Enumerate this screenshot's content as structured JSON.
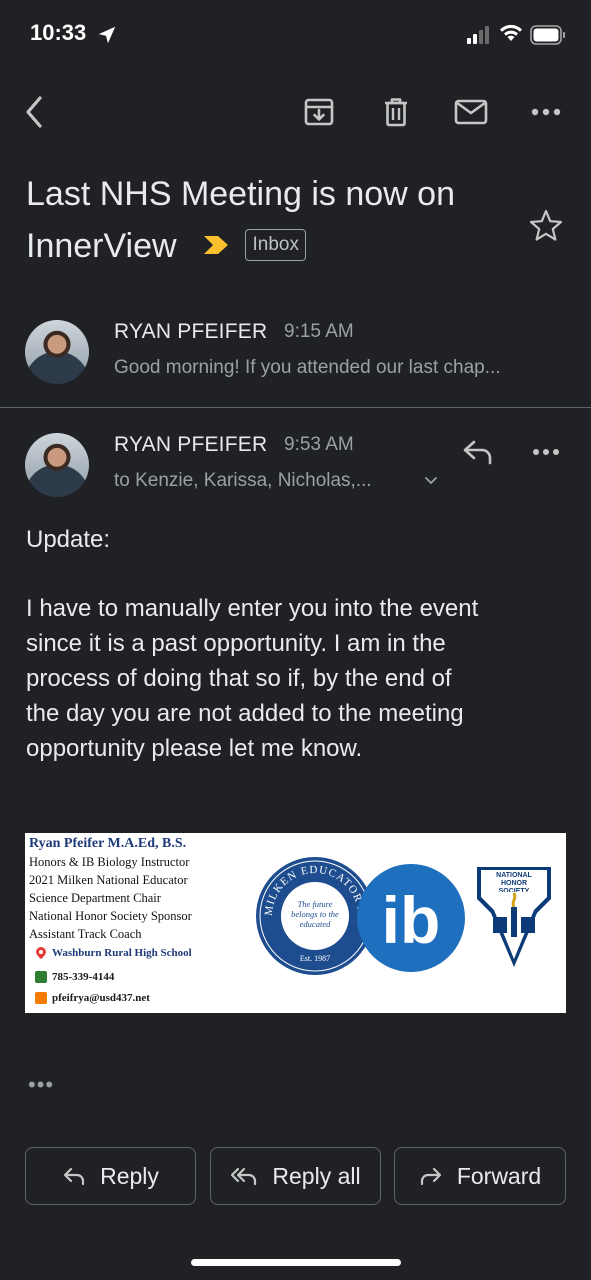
{
  "status_bar": {
    "time": "10:33"
  },
  "toolbar": {
    "back_icon": "chevron-left-icon",
    "archive_icon": "archive-icon",
    "delete_icon": "trash-icon",
    "mark_unread_icon": "mail-icon",
    "more_icon": "more-horizontal-icon"
  },
  "email": {
    "subject": "Last NHS Meeting is now on InnerView",
    "label": "Inbox",
    "messages": [
      {
        "sender": "RYAN PFEIFER",
        "time": "9:15 AM",
        "snippet": "Good morning! If you attended our last chap..."
      },
      {
        "sender": "RYAN PFEIFER",
        "time": "9:53 AM",
        "recipients": "to Kenzie, Karissa, Nicholas,...",
        "body": [
          "Update:",
          "I have to manually enter you into the event",
          "since it is a past opportunity. I am in the",
          "process of doing that so if, by the end of",
          "the day you are not added to the meeting",
          "opportunity please let me know."
        ]
      }
    ]
  },
  "signature": {
    "name": "Ryan Pfeifer M.A.Ed, B.S.",
    "lines": [
      "Honors & IB Biology Instructor",
      "2021 Milken National Educator",
      "Science Department Chair",
      "National Honor Society Sponsor",
      "Assistant Track Coach"
    ],
    "school": "Washburn Rural High School",
    "phone": "785-339-4144",
    "email": "pfeifrya@usd437.net",
    "milken_ring": "MILKEN EDUCATOR AWARDS",
    "milken_center": "The future belongs to the educated",
    "milken_est": "Est. 1987",
    "ib_logo": "ib",
    "nhs_text": "NATIONAL HONOR SOCIETY"
  },
  "footer": {
    "reply": "Reply",
    "reply_all": "Reply all",
    "forward": "Forward",
    "more_dots": "•••"
  },
  "colors": {
    "background": "#202124",
    "text": "#e8eaed",
    "muted": "#9aa0a6",
    "important_marker": "#f9c02d",
    "ib_blue": "#1f6fbf"
  }
}
